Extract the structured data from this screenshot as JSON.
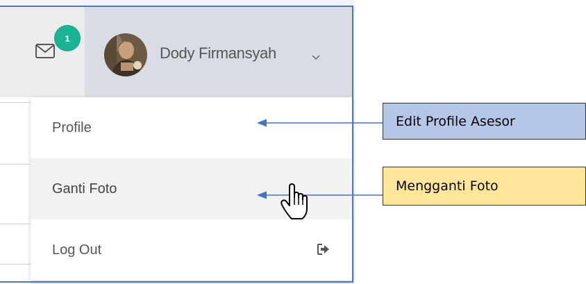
{
  "header": {
    "mail_badge_count": "1",
    "user_name": "Dody Firmansyah",
    "icons": {
      "mail": "envelope-icon",
      "dropdown": "chevron-down-icon",
      "avatar": "user-avatar-photo"
    }
  },
  "dropdown_menu": {
    "items": [
      {
        "label": "Profile",
        "state": "normal"
      },
      {
        "label": "Ganti Foto",
        "state": "hover"
      },
      {
        "label": "Log Out",
        "icon": "sign-out-icon",
        "state": "normal"
      }
    ]
  },
  "annotations": [
    {
      "text": "Edit Profile Asesor",
      "target": "Profile",
      "color": "#b4c7e7"
    },
    {
      "text": "Mengganti Foto",
      "target": "Ganti Foto",
      "color": "#ffe699"
    }
  ],
  "colors": {
    "badge": "#1ab394",
    "arrow": "#4472c4",
    "frame": "#4a78c9"
  }
}
